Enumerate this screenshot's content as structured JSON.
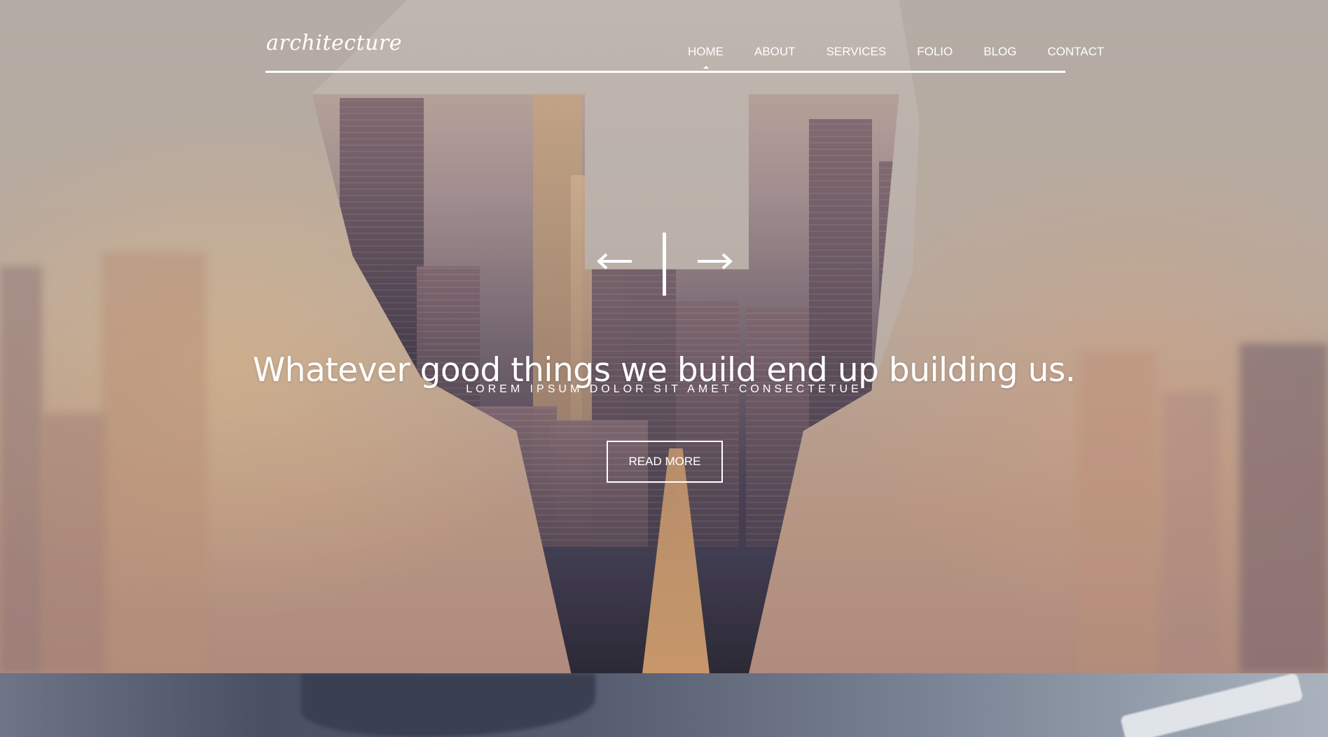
{
  "header": {
    "logo": "architecture",
    "nav": [
      {
        "label": "HOME",
        "active": true
      },
      {
        "label": "ABOUT",
        "active": false
      },
      {
        "label": "SERVICES",
        "active": false
      },
      {
        "label": "FOLIO",
        "active": false
      },
      {
        "label": "BLOG",
        "active": false
      },
      {
        "label": "CONTACT",
        "active": false
      }
    ]
  },
  "hero": {
    "headline": "Whatever good things we build end up building us.",
    "subline": "LOREM IPSUM DOLOR SIT AMET CONSECTETUE",
    "cta_label": "READ MORE",
    "prev_icon": "arrow-left-icon",
    "next_icon": "arrow-right-icon"
  },
  "colors": {
    "text": "#ffffff",
    "accent": "#ffffff"
  }
}
